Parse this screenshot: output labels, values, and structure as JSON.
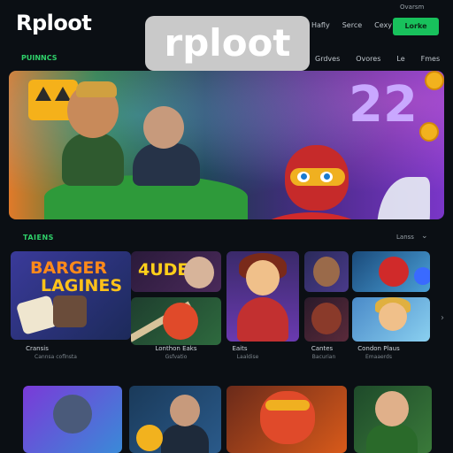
{
  "header": {
    "logo": "Rploot",
    "watermark": "rploot",
    "nav": [
      "Hafly",
      "Serce",
      "Cexy"
    ],
    "top_small": "Ovarsm",
    "cta_label": "Lorke"
  },
  "subnav": {
    "left": "PUINNCS",
    "right": [
      "Grdves",
      "Ovores",
      "Le",
      "Fmes"
    ]
  },
  "hero": {
    "number": "22"
  },
  "section": {
    "title": "TAIENS",
    "right": "Lanss"
  },
  "tiles": [
    {
      "name": "barger-lagines",
      "title_line1": "BARGER",
      "title_line2": "LAGINES",
      "label": "Cransis",
      "sublabel": "Cannsa coflnsta"
    },
    {
      "name": "4ude",
      "title": "4UDE"
    },
    {
      "name": "lonthon",
      "label": "Lonthon Eaks",
      "sublabel": "Gsfvatio"
    },
    {
      "name": "eaits",
      "label": "Eaits",
      "sublabel": "Laaldise"
    },
    {
      "name": "cantes",
      "label": "Cantes",
      "sublabel": "Bacurian"
    },
    {
      "name": "condon-plaus",
      "label": "Condon Plaus",
      "sublabel": "Emaaerds"
    }
  ],
  "colors": {
    "accent": "#18c15c",
    "background": "#0b0f14",
    "section_title": "#2fd06a"
  }
}
